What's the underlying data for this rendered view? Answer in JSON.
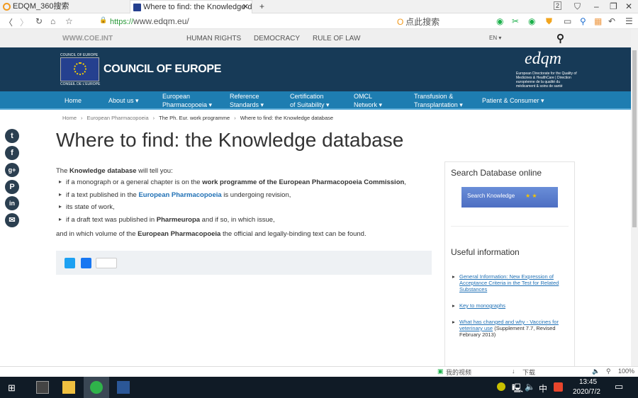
{
  "browser": {
    "tabs": [
      {
        "title": "EDQM_360搜索"
      },
      {
        "title": "Where to find: the Knowledge d"
      }
    ],
    "tab_count": "2",
    "url_scheme": "https://",
    "url_rest": "www.edqm.eu/",
    "search_placeholder": "点此搜索"
  },
  "topstrip": {
    "site": "WWW.COE.INT",
    "links": [
      "HUMAN RIGHTS",
      "DEMOCRACY",
      "RULE OF LAW"
    ],
    "lang": "EN ▾"
  },
  "header": {
    "logo_top": "COUNCIL OF EUROPE",
    "logo_bottom": "CONSEIL DE L'EUROPE",
    "title": "COUNCIL OF EUROPE",
    "edqm": "edqm",
    "edqm_sub": "European Directorate for the Quality of Medicines & HealthCare | Direction européenne de la qualité du médicament & soins de santé"
  },
  "nav": [
    {
      "l1": "Home",
      "l2": ""
    },
    {
      "l1": "About us ▾",
      "l2": ""
    },
    {
      "l1": "European",
      "l2": "Pharmacopoeia ▾"
    },
    {
      "l1": "Reference",
      "l2": "Standards ▾"
    },
    {
      "l1": "Certification",
      "l2": "of Suitability ▾"
    },
    {
      "l1": "OMCL",
      "l2": "Network ▾"
    },
    {
      "l1": "Transfusion &",
      "l2": "Transplantation ▾"
    },
    {
      "l1": "Patient & Consumer ▾",
      "l2": ""
    }
  ],
  "breadcrumb": [
    "Home",
    "›",
    "European Pharmacopoeia",
    "›",
    "The Ph. Eur. work programme",
    "›",
    "Where to find: the Knowledge database"
  ],
  "page_title": "Where to find: the Knowledge database",
  "content": {
    "intro_pre": "The ",
    "intro_bold": "Knowledge database",
    "intro_post": " will tell you:",
    "items": [
      {
        "pre": "if a monograph or a general chapter is on the ",
        "bold": "work programme of the European Pharmacopoeia Commission",
        "post": ","
      },
      {
        "pre": "if a text published in the ",
        "bold": "European Pharmacopoeia",
        "post": " is undergoing revision,"
      },
      {
        "pre": "its state of work,",
        "bold": "",
        "post": ""
      },
      {
        "pre": "if a draft text was published in ",
        "bold": "Pharmeuropa",
        "post": " and if so, in which issue,"
      }
    ],
    "outro_pre": "and in which volume of the ",
    "outro_bold": "European Pharmacopoeia",
    "outro_post": " the official and legally-binding text can be found."
  },
  "sidebar": {
    "search_title": "Search Database online",
    "search_button": "Search Knowledge",
    "useful_title": "Useful information",
    "links": [
      {
        "text": "General Information: New Expression of Acceptance Criteria in the Test for Related Substances",
        "extra": ""
      },
      {
        "text": "Key to monographs",
        "extra": ""
      },
      {
        "text": "What has changed and why - Vaccines for veterinary use",
        "extra": " (Supplement 7.7, Revised February 2013)"
      }
    ]
  },
  "share_icons": [
    "t",
    "f",
    "g+",
    "P",
    "in",
    "✉"
  ],
  "statusbar": {
    "video": "我的视频",
    "download": "下载",
    "zoom": "100%"
  },
  "taskbar": {
    "time": "13:45",
    "date": "2020/7/2",
    "ime": "中"
  }
}
